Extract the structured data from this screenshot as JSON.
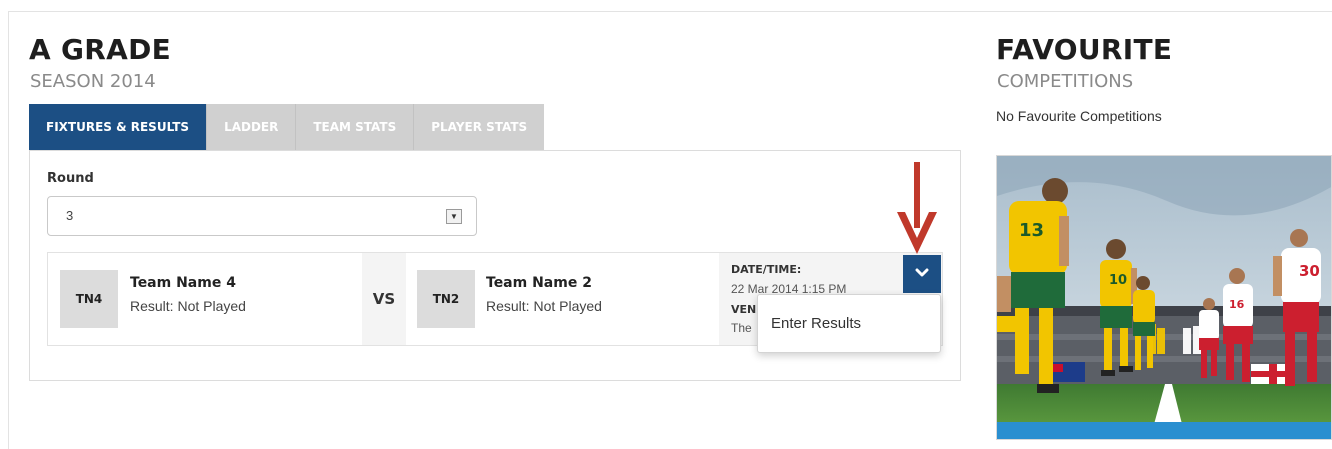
{
  "competition": {
    "title": "A GRADE",
    "season": "SEASON 2014"
  },
  "tabs": [
    {
      "label": "FIXTURES & RESULTS",
      "active": true
    },
    {
      "label": "LADDER",
      "active": false
    },
    {
      "label": "TEAM STATS",
      "active": false
    },
    {
      "label": "PLAYER STATS",
      "active": false
    }
  ],
  "round": {
    "label": "Round",
    "selected": "3"
  },
  "fixture": {
    "home": {
      "abbr": "TN4",
      "name": "Team Name 4",
      "result": "Result: Not Played"
    },
    "vs": "VS",
    "away": {
      "abbr": "TN2",
      "name": "Team Name 2",
      "result": "Result: Not Played"
    },
    "datetime_label": "DATE/TIME:",
    "datetime_value": "22 Mar 2014 1:15 PM",
    "venue_label": "VEN",
    "venue_value": "The"
  },
  "actions_menu": {
    "items": [
      "Enter Results"
    ]
  },
  "favourites": {
    "title": "FAVOURITE",
    "subtitle": "COMPETITIONS",
    "empty_text": "No Favourite Competitions"
  },
  "players": {
    "jersey_numbers": [
      "13",
      "10",
      "16",
      "30"
    ]
  },
  "colors": {
    "primary": "#1c4f84",
    "tab_inactive": "#d0d0d0",
    "arrow": "#c0392b"
  }
}
